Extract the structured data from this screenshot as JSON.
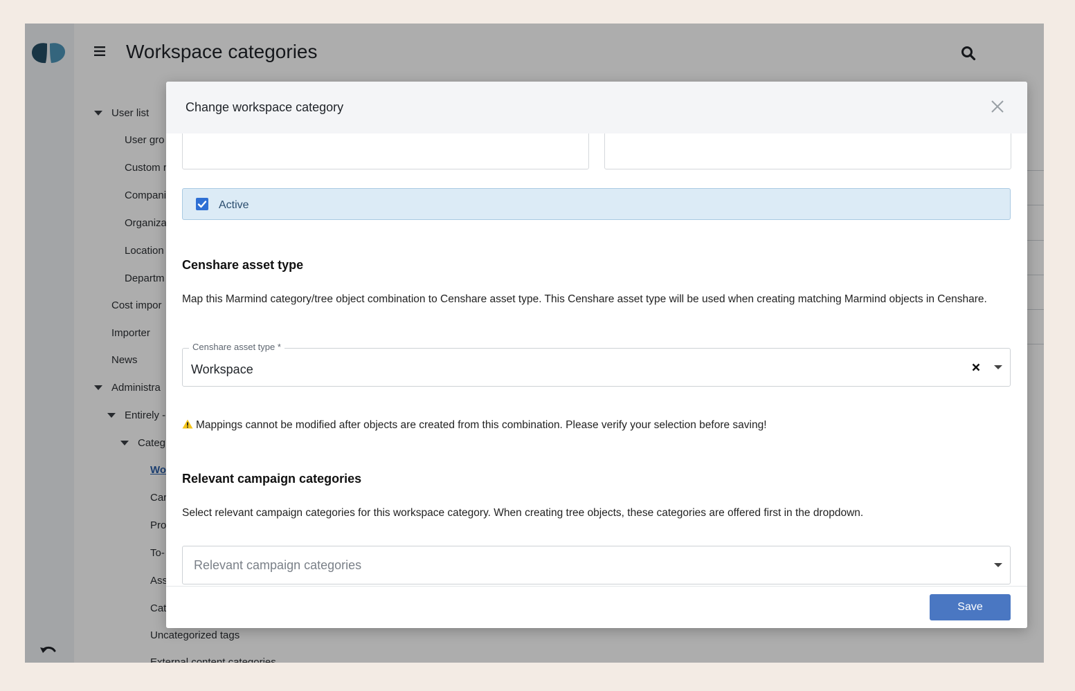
{
  "header": {
    "title": "Workspace categories"
  },
  "sidebar": {
    "items": [
      {
        "label": "User list",
        "level": 0,
        "expanded": true
      },
      {
        "label": "User gro",
        "level": 1
      },
      {
        "label": "Custom r",
        "level": 1
      },
      {
        "label": "Compani",
        "level": 1
      },
      {
        "label": "Organiza",
        "level": 1
      },
      {
        "label": "Location",
        "level": 1
      },
      {
        "label": "Departm",
        "level": 1
      },
      {
        "label": "Cost impor",
        "level": 0
      },
      {
        "label": "Importer",
        "level": 0
      },
      {
        "label": "News",
        "level": 0
      },
      {
        "label": "Administra",
        "level": 0,
        "expanded": true
      },
      {
        "label": "Entirely -",
        "level": 1,
        "expanded": true
      },
      {
        "label": "Categ",
        "level": 2,
        "expanded": true
      },
      {
        "label": "Wo",
        "level": 3,
        "active": true
      },
      {
        "label": "Car",
        "level": 3
      },
      {
        "label": "Pro",
        "level": 3
      },
      {
        "label": "To-",
        "level": 3
      },
      {
        "label": "Ass",
        "level": 3
      },
      {
        "label": "Cat",
        "level": 3
      },
      {
        "label": "Uncategorized tags",
        "level": 3
      },
      {
        "label": "External content categories",
        "level": 3
      }
    ]
  },
  "modal": {
    "title": "Change workspace category",
    "active_label": "Active",
    "active_checked": true,
    "censhare_section_title": "Censhare asset type",
    "censhare_description": "Map this Marmind category/tree object combination to Censhare asset type. This Censhare asset type will be used when creating matching Marmind objects in Censhare.",
    "censhare_field_label": "Censhare asset type *",
    "censhare_field_value": "Workspace",
    "warning_text": "Mappings cannot be modified after objects are created from this combination. Please verify your selection before saving!",
    "campaign_section_title": "Relevant campaign categories",
    "campaign_description": "Select relevant campaign categories for this workspace category. When creating tree objects, these categories are offered first in the dropdown.",
    "campaign_placeholder": "Relevant campaign categories",
    "save_label": "Save"
  },
  "colors": {
    "primary": "#4a77c2",
    "checkbox": "#2e6fd4",
    "active_bg": "#dcebf6",
    "page_bg": "#f3ebe4",
    "logo_dark": "#264f66",
    "logo_light": "#4d96b8"
  }
}
